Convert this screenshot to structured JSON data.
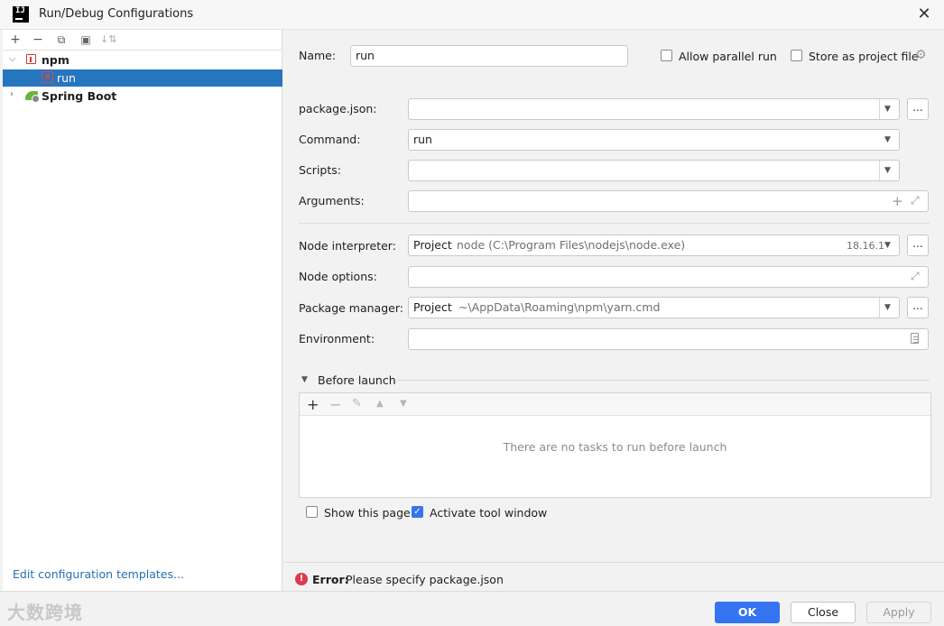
{
  "window": {
    "title": "Run/Debug Configurations",
    "logo_text": "IJ"
  },
  "toolbar": {
    "add": "+",
    "remove": "−",
    "copy": "⧉",
    "folder": "▣",
    "sort": "↓⇅"
  },
  "tree": {
    "npm_label": "npm",
    "run_label": "run",
    "spring_label": "Spring Boot"
  },
  "left": {
    "edit_templates": "Edit configuration templates..."
  },
  "form": {
    "name_label": "Name:",
    "name_value": "run",
    "allow_parallel": "Allow parallel run",
    "store_project": "Store as project file",
    "package_json_label": "package.json:",
    "package_json_value": "",
    "command_label": "Command:",
    "command_value": "run",
    "scripts_label": "Scripts:",
    "scripts_value": "",
    "arguments_label": "Arguments:",
    "node_interp_label": "Node interpreter:",
    "node_interp_project": "Project",
    "node_interp_path": "node (C:\\Program Files\\nodejs\\node.exe)",
    "node_interp_version": "18.16.1",
    "node_options_label": "Node options:",
    "pkg_manager_label": "Package manager:",
    "pkg_manager_project": "Project",
    "pkg_manager_path": "~\\AppData\\Roaming\\npm\\yarn.cmd",
    "environment_label": "Environment:",
    "browse": "...",
    "before_launch": "Before launch",
    "no_tasks": "There are no tasks to run before launch",
    "show_page": "Show this page",
    "activate_tool": "Activate tool window"
  },
  "status": {
    "error_prefix": "Error:",
    "error_text": "Please specify package.json"
  },
  "buttons": {
    "ok": "OK",
    "close": "Close",
    "apply": "Apply"
  },
  "watermark": "大数跨境",
  "colors": {
    "accent": "#3574f0",
    "selection": "#2675bf",
    "error": "#db3b4b",
    "link": "#2470b3"
  }
}
